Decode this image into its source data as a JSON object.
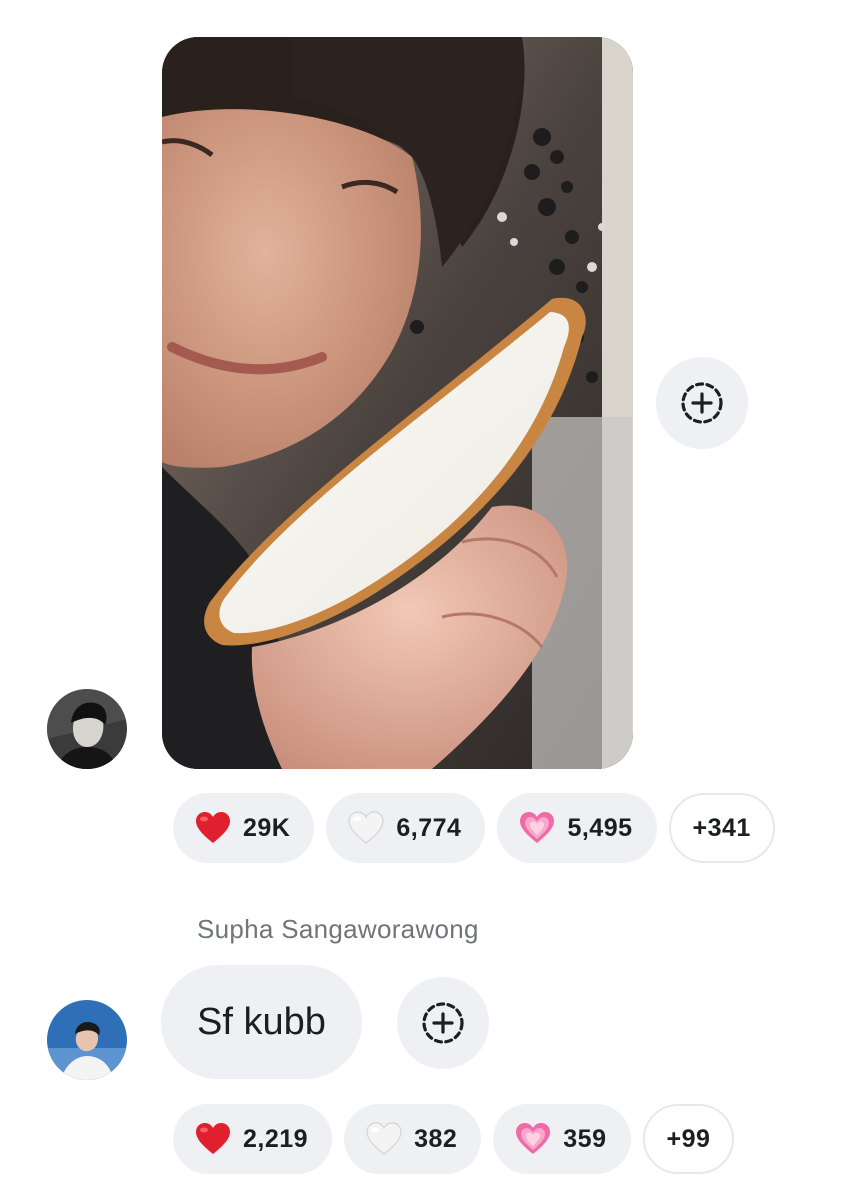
{
  "messages": [
    {
      "type": "photo",
      "avatar": "sender-avatar-dark",
      "reactions": [
        {
          "emoji": "red-heart",
          "count": "29K"
        },
        {
          "emoji": "white-heart",
          "count": "6,774"
        },
        {
          "emoji": "pink-sparkling-heart",
          "count": "5,495"
        }
      ],
      "more_reactions": "+341"
    },
    {
      "type": "text",
      "sender": "Supha Sangaworawong",
      "text": "Sf kubb",
      "avatar": "sender-avatar-blue",
      "reactions": [
        {
          "emoji": "red-heart",
          "count": "2,219"
        },
        {
          "emoji": "white-heart",
          "count": "382"
        },
        {
          "emoji": "pink-sparkling-heart",
          "count": "359"
        }
      ],
      "more_reactions": "+99"
    }
  ],
  "icons": {
    "add_reaction": "add-reaction-icon"
  },
  "colors": {
    "bubble_bg": "#eef0f3",
    "text": "#1c1e21",
    "muted": "#707579",
    "red_heart": "#e0202e",
    "pink_heart": "#f06aa8"
  }
}
